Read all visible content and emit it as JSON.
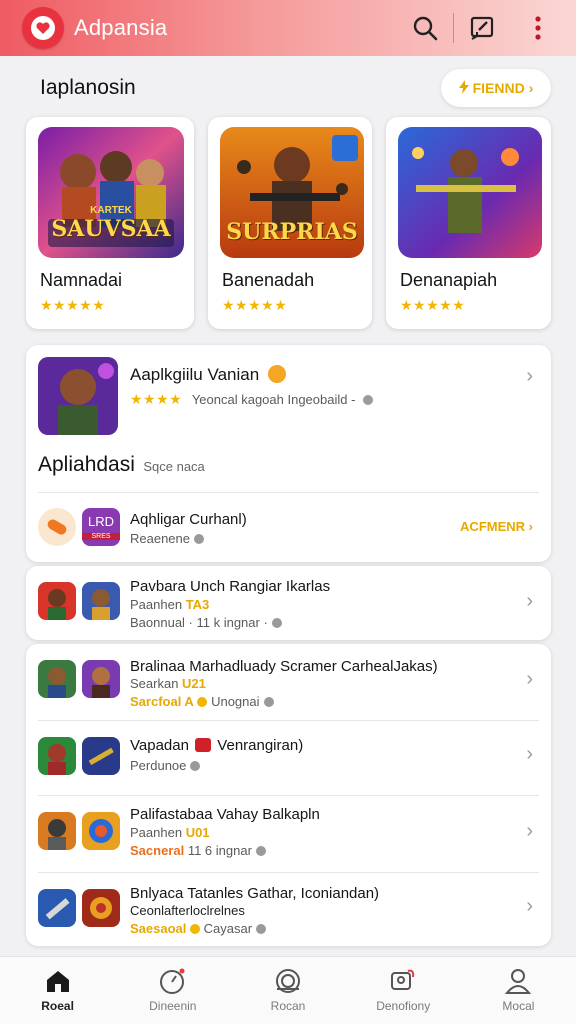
{
  "app": {
    "title": "Adpansia"
  },
  "header": {
    "icons": [
      "search-icon",
      "edit-icon",
      "more-vertical-icon"
    ]
  },
  "section": {
    "title": "Iaplanosin",
    "friend_button": "FIENND"
  },
  "featured": [
    {
      "name": "Namnadai",
      "art_text": "SAUVSAA",
      "art_top": "KARTEK",
      "stars": "★★★★★"
    },
    {
      "name": "Banenadah",
      "art_text": "SURPRIAS",
      "stars": "★★★★★"
    },
    {
      "name": "Denanapiah",
      "stars": "★★★★★"
    }
  ],
  "spotlight": {
    "title": "Aaplkgiilu Vanian",
    "stars": "★★★★",
    "subtitle": "Yeoncal kagoah Ingeobaild -",
    "section_title": "Apliahdasi",
    "section_sub": "Sqce naca",
    "item": {
      "title": "Aqhligar Curhanl)",
      "subtitle": "Reaenene",
      "badge": "LRD",
      "badge_sub": "SRES",
      "action": "ACFMENR"
    }
  },
  "list": [
    {
      "title": "Pavbara Unch Rangiar Ikarlas",
      "sub1_label": "Paanhen",
      "sub1_tag": "TA3",
      "sub2": "Baonnual · 11 k ingnar ·"
    },
    {
      "title": "Bralinaa Marhadluady Scramer CarhealJakas)",
      "sub1_label": "Searkan",
      "sub1_tag": "U21",
      "sub2_tag": "Sarcfoal A",
      "sub2": "Unognai"
    },
    {
      "title": "Vapadan",
      "title_tag": "Venrangiran)",
      "sub1_label": "Perdunoe"
    },
    {
      "title": "Palifastabaa Vahay Balkapln",
      "sub1_label": "Paanhen",
      "sub1_tag": "U01",
      "sub2_tag": "Sacneral",
      "sub2": "11 6 ingnar"
    },
    {
      "title": "Bnlyaca Tatanles Gathar, Iconiandan)",
      "sub1_label": "Ceonlafterloclrelnes",
      "sub2_tag": "Saesaoal",
      "sub2": "Cayasar"
    }
  ],
  "tabs": [
    {
      "label": "Roeal",
      "icon": "home-icon",
      "active": true
    },
    {
      "label": "Dineenin",
      "icon": "discover-icon",
      "active": false
    },
    {
      "label": "Rocan",
      "icon": "rocket-icon",
      "active": false
    },
    {
      "label": "Denofiony",
      "icon": "games-icon",
      "active": false
    },
    {
      "label": "Mocal",
      "icon": "profile-icon",
      "active": false
    }
  ],
  "colors": {
    "accent": "#ef5b62",
    "star": "#f2b600",
    "tag": "#e7a800"
  }
}
